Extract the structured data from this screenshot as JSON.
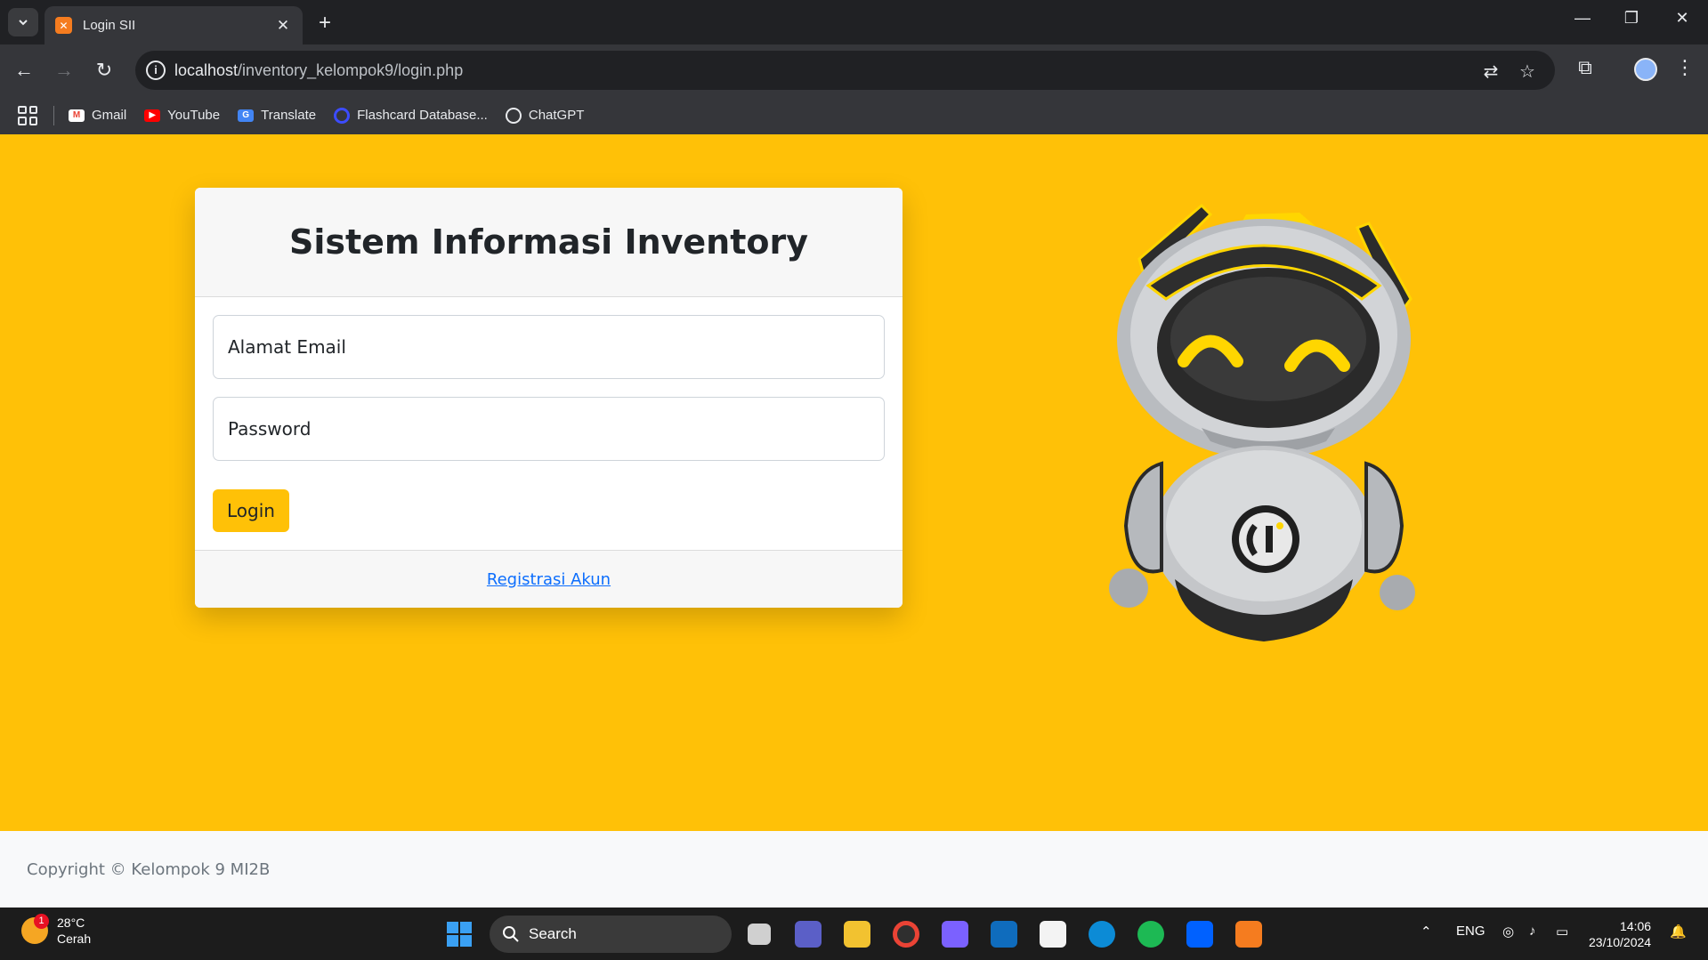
{
  "browser": {
    "tab_title": "Login SII",
    "url_host": "localhost",
    "url_path": "/inventory_kelompok9/login.php",
    "bookmarks": [
      {
        "label": "Gmail",
        "icon": "gmail-icon",
        "color": "#ea4335"
      },
      {
        "label": "YouTube",
        "icon": "youtube-icon",
        "color": "#ff0000"
      },
      {
        "label": "Translate",
        "icon": "translate-icon",
        "color": "#4285f4"
      },
      {
        "label": "Flashcard Database...",
        "icon": "flashcard-icon",
        "color": "#3c4cff"
      },
      {
        "label": "ChatGPT",
        "icon": "chatgpt-icon",
        "color": "#ffffff"
      }
    ]
  },
  "login": {
    "title": "Sistem Informasi Inventory",
    "email_placeholder": "Alamat Email",
    "password_placeholder": "Password",
    "login_button": "Login",
    "register_link": "Registrasi Akun"
  },
  "footer": {
    "copyright": "Copyright © Kelompok 9 MI2B"
  },
  "taskbar": {
    "weather_temp": "28°C",
    "weather_desc": "Cerah",
    "weather_badge": "1",
    "search_label": "Search",
    "language": "ENG",
    "time": "14:06",
    "date": "23/10/2024"
  },
  "colors": {
    "page_background": "#ffc107",
    "link": "#0d6efd",
    "button": "#ffc107"
  }
}
